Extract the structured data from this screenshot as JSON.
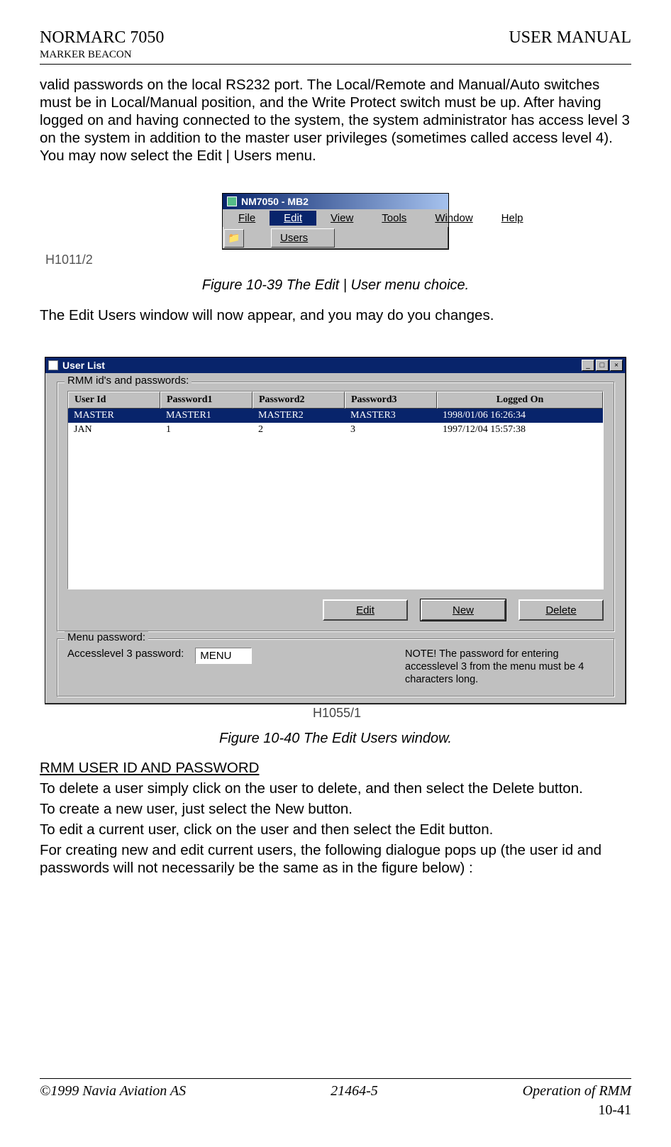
{
  "header": {
    "product": "NORMARC 7050",
    "doc_type": "USER MANUAL",
    "subtitle": "MARKER BEACON"
  },
  "body": {
    "para1": "valid passwords on the local RS232 port. The Local/Remote and Manual/Auto switches must be in Local/Manual position, and the Write Protect switch must be up. After having logged on and having connected to the system, the system administrator has access level 3 on the system in addition to the master user privileges (sometimes called access level 4). You may now select the Edit | Users menu.",
    "para2": "The Edit Users window will now appear, and you may do you changes."
  },
  "fig1": {
    "title": "NM7050 - MB2",
    "menus": {
      "file": "File",
      "edit": "Edit",
      "view": "View",
      "tools": "Tools",
      "window": "Window",
      "help": "Help"
    },
    "dropdown_item": "Users",
    "ref": "H1011/2",
    "caption": "Figure 10-39 The Edit | User menu choice."
  },
  "fig2": {
    "title": "User List",
    "group1": "RMM id's and passwords:",
    "columns": {
      "c1": "User Id",
      "c2": "Password1",
      "c3": "Password2",
      "c4": "Password3",
      "c5": "Logged On"
    },
    "rows": [
      {
        "user": "MASTER",
        "p1": "MASTER1",
        "p2": "MASTER2",
        "p3": "MASTER3",
        "logged": "1998/01/06 16:26:34"
      },
      {
        "user": "JAN",
        "p1": "1",
        "p2": "2",
        "p3": "3",
        "logged": "1997/12/04 15:57:38"
      }
    ],
    "buttons": {
      "edit": "Edit",
      "new": "New",
      "delete": "Delete"
    },
    "group2": "Menu password:",
    "al3_label": "Accesslevel 3 password:",
    "al3_value": "MENU",
    "note": "NOTE! The password for entering accesslevel 3 from the menu must be 4 characters long.",
    "minimize": "_",
    "maximize": "□",
    "close": "×",
    "ref": "H1055/1",
    "caption": "Figure 10-40 The Edit Users window."
  },
  "section": {
    "heading": "RMM USER ID AND PASSWORD",
    "l1": "To delete a user simply click on the user to delete, and then select the Delete button.",
    "l2": "To create a new user, just select the New button.",
    "l3": "To edit a current user, click on the user and then select the Edit button.",
    "l4": "For creating new and edit current users, the following dialogue pops up (the user id and passwords will not necessarily be the same as in the figure below) :"
  },
  "footer": {
    "copyright": "©1999 Navia Aviation AS",
    "docnum": "21464-5",
    "chapter": "Operation of RMM",
    "page": "10-41"
  }
}
